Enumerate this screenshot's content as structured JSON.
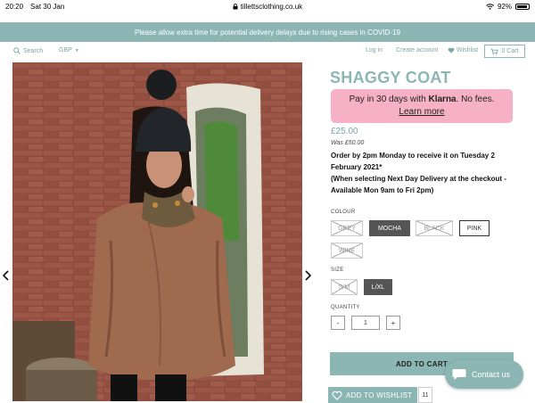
{
  "status": {
    "time": "20:20",
    "date": "Sat 30 Jan",
    "url": "tillettsclothing.co.uk",
    "battery": "92%"
  },
  "banner": {
    "text": "Please allow extra time for potential delivery delays due to rising cases in COVID-19"
  },
  "nav": {
    "search": "Search",
    "currency": "GBP",
    "login": "Log in",
    "create_account": "Create account",
    "wishlist": "Wishlist",
    "cart": "0 Cart"
  },
  "product": {
    "title": "SHAGGY COAT",
    "klarna": {
      "prefix": "Pay in 30 days with ",
      "brand": "Klarna",
      "suffix": ". No fees.",
      "learn_more": "Learn more"
    },
    "price": "£25.00",
    "was": "Was £50.00",
    "delivery_line1": "Order by 2pm Monday to receive it on Tuesday 2 February 2021*",
    "delivery_line2": "(When selecting Next Day Delivery at the checkout - Available Mon 9am to Fri 2pm)",
    "colour_label": "COLOUR",
    "colours": [
      "GREY",
      "MOCHA",
      "BLACK",
      "PINK",
      "WINE"
    ],
    "size_label": "SIZE",
    "sizes": [
      "S/M",
      "L/XL"
    ],
    "quantity_label": "QUANTITY",
    "qty_minus": "-",
    "qty_value": "1",
    "qty_plus": "+",
    "add_to_cart": "ADD TO CART",
    "add_to_wishlist": "ADD TO WISHLIST",
    "wishlist_count": "11"
  },
  "chat": {
    "label": "Contact us"
  },
  "colors": {
    "teal": "#8bb6b4",
    "klarna_pink": "#f7b1c6",
    "selected": "#555555"
  }
}
